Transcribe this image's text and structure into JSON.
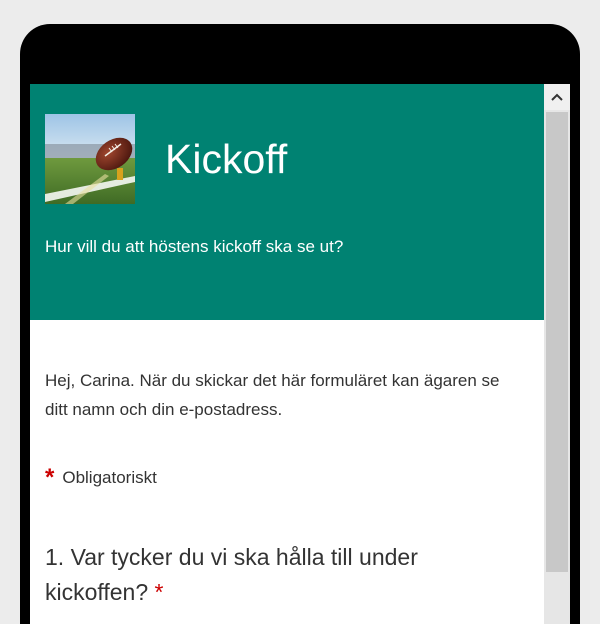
{
  "form": {
    "title": "Kickoff",
    "subtitle": "Hur vill du att höstens kickoff ska se ut?",
    "header_color": "#008272",
    "notice": "Hej, Carina. När du skickar det här formuläret kan ägaren se ditt namn och din e-postadress.",
    "required_marker": "*",
    "required_label": "Obligatoriskt",
    "questions": [
      {
        "text": "1. Var tycker du vi ska hålla till under kickoffen?",
        "required_marker": "*"
      }
    ]
  },
  "colors": {
    "accent": "#008272",
    "required": "#cc0000"
  },
  "icons": {
    "scroll_up": "chevron-up-icon",
    "header_image": "american-football-image"
  }
}
